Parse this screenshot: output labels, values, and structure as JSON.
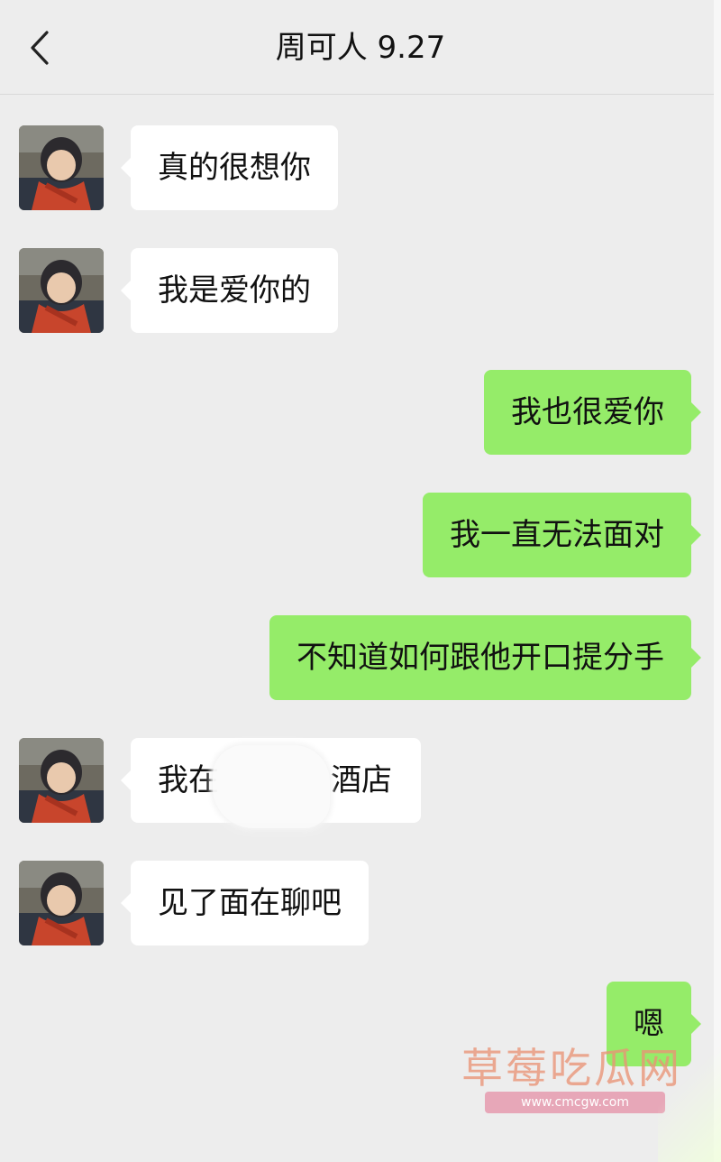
{
  "header": {
    "title": "周可人 9.27",
    "back_icon": "chevron-left-icon"
  },
  "messages": [
    {
      "side": "in",
      "text": "真的很想你"
    },
    {
      "side": "in",
      "text": "我是爱你的"
    },
    {
      "side": "out",
      "text": "我也很爱你"
    },
    {
      "side": "out",
      "text": "我一直无法面对"
    },
    {
      "side": "out",
      "text": "不知道如何跟他开口提分手"
    },
    {
      "side": "in",
      "text": "我在酒店",
      "prefix": "我在",
      "suffix": "酒店",
      "redacted": true
    },
    {
      "side": "in",
      "text": "见了面在聊吧"
    },
    {
      "side": "out",
      "text": "嗯"
    }
  ],
  "watermark": {
    "text": "草莓吃瓜网",
    "url": "www.cmcgw.com"
  },
  "colors": {
    "background": "#ededed",
    "incoming_bubble": "#ffffff",
    "outgoing_bubble": "#95ec69"
  }
}
